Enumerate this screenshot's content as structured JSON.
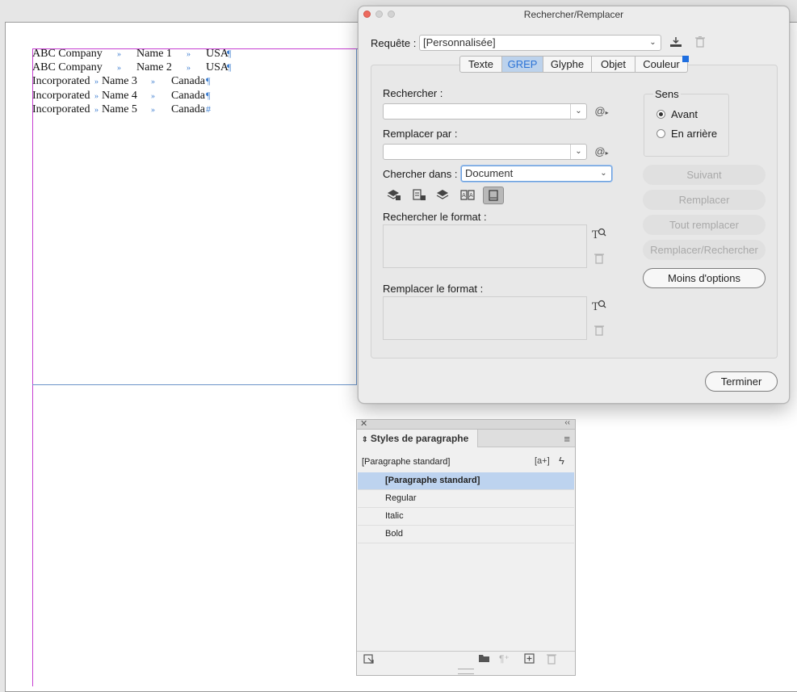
{
  "document": {
    "rows": [
      {
        "c1": "ABC Company",
        "c2": "Name 1",
        "c3": "USA"
      },
      {
        "c1": "ABC Company",
        "c2": "Name 2",
        "c3": "USA"
      },
      {
        "c1": "Incorporated",
        "c2": "Name 3",
        "c3": "Canada"
      },
      {
        "c1": "Incorporated",
        "c2": "Name 4",
        "c3": "Canada"
      },
      {
        "c1": "Incorporated",
        "c2": "Name 5",
        "c3": "Canada"
      }
    ],
    "tab_mark": "»",
    "para_mark": "¶",
    "end_mark": "#"
  },
  "dialog": {
    "title": "Rechercher/Remplacer",
    "query_label": "Requête :",
    "query_value": "[Personnalisée]",
    "tabs": [
      "Texte",
      "GREP",
      "Glyphe",
      "Objet",
      "Couleur"
    ],
    "active_tab": "GREP",
    "find_label": "Rechercher :",
    "find_value": "",
    "replace_label": "Remplacer par :",
    "replace_value": "",
    "search_in_label": "Chercher dans :",
    "search_in_value": "Document",
    "find_format_label": "Rechercher le format :",
    "replace_format_label": "Remplacer le format :",
    "direction_label": "Sens",
    "direction_forward": "Avant",
    "direction_backward": "En arrière",
    "buttons": {
      "next": "Suivant",
      "replace": "Remplacer",
      "replace_all": "Tout remplacer",
      "replace_find": "Remplacer/Rechercher",
      "fewer_options": "Moins d'options",
      "done": "Terminer"
    }
  },
  "panel": {
    "tab_title": "Styles de paragraphe",
    "current_style": "[Paragraphe standard]",
    "new_from_selection_symbol": "[a+]",
    "styles": [
      "[Paragraphe standard]",
      "Regular",
      "Italic",
      "Bold"
    ],
    "selected_index": 0
  },
  "colors": {
    "margin_guide": "#c63fd2",
    "frame_edge": "#6b94c9",
    "accent_blue": "#2b73d6",
    "close_red": "#ed6a5e"
  }
}
